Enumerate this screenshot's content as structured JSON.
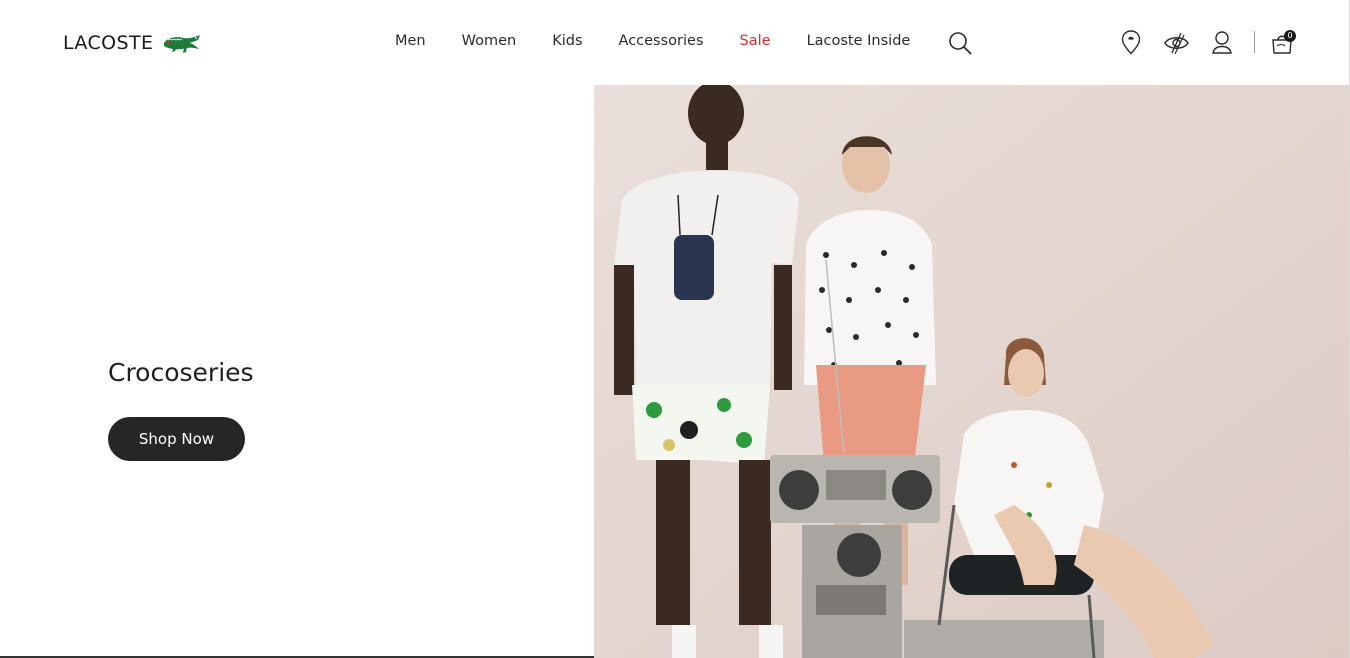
{
  "header": {
    "logo_text": "LACOSTE",
    "logo_icon": "crocodile-icon",
    "nav": [
      {
        "label": "Men"
      },
      {
        "label": "Women"
      },
      {
        "label": "Kids"
      },
      {
        "label": "Accessories"
      },
      {
        "label": "Sale"
      },
      {
        "label": "Lacoste Inside"
      }
    ],
    "icons": [
      "search-icon",
      "store-locator-icon",
      "accessibility-icon",
      "account-icon",
      "cart-icon"
    ],
    "cart_count": "0"
  },
  "hero": {
    "title": "Crocoseries",
    "cta_label": "Shop Now"
  },
  "colors": {
    "sale": "#d62d2d",
    "button_bg": "#262626",
    "logo_green": "#1e7a3a",
    "photo_bg": "#e8dcd6"
  }
}
